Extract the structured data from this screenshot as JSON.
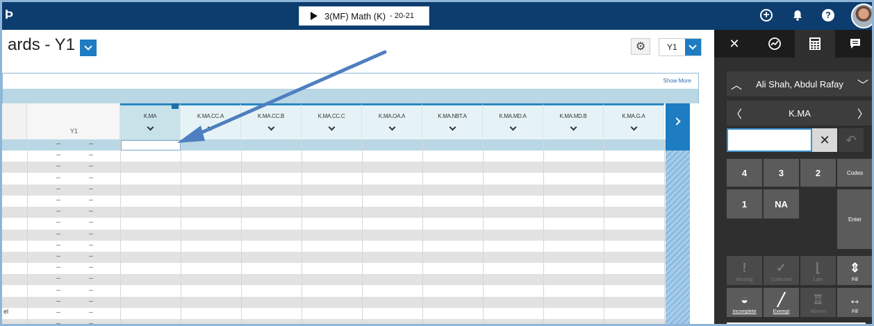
{
  "topbar": {
    "logo_fragment": "Þ",
    "section_name": "3(MF) Math (K)",
    "section_year": "- 20-21"
  },
  "header": {
    "title": "ards - Y1",
    "term": "Y1",
    "show_more": "Show More"
  },
  "grid": {
    "y1_label": "Y1",
    "columns": [
      "K.MA",
      "K.MA.CC.A",
      "K.MA.CC.B",
      "K.MA.CC.C",
      "K.MA.OA.A",
      "K.MA.NBT.A",
      "K.MA.MD.A",
      "K.MA.MD.B",
      "K.MA.G.A"
    ],
    "dash": "--",
    "row_count": 17,
    "footer_label": "el"
  },
  "panel": {
    "student_name": "Ali Shah, Abdul Rafay",
    "standard": "K.MA",
    "keys": {
      "k4": "4",
      "k3": "3",
      "k2": "2",
      "codes": "Codes",
      "k1": "1",
      "na": "NA",
      "enter": "Enter",
      "missing": "Missing",
      "collected": "Collected",
      "late": "Late",
      "fill_vertical": "Fill",
      "incomplete": "Incomplete",
      "exempt": "Exempt",
      "absent": "Absent",
      "fill_horizontal": "Fill"
    }
  },
  "colors": {
    "topbar": "#0d3d6e",
    "accent": "#1e7cc2",
    "panel": "#2f2f2f"
  }
}
